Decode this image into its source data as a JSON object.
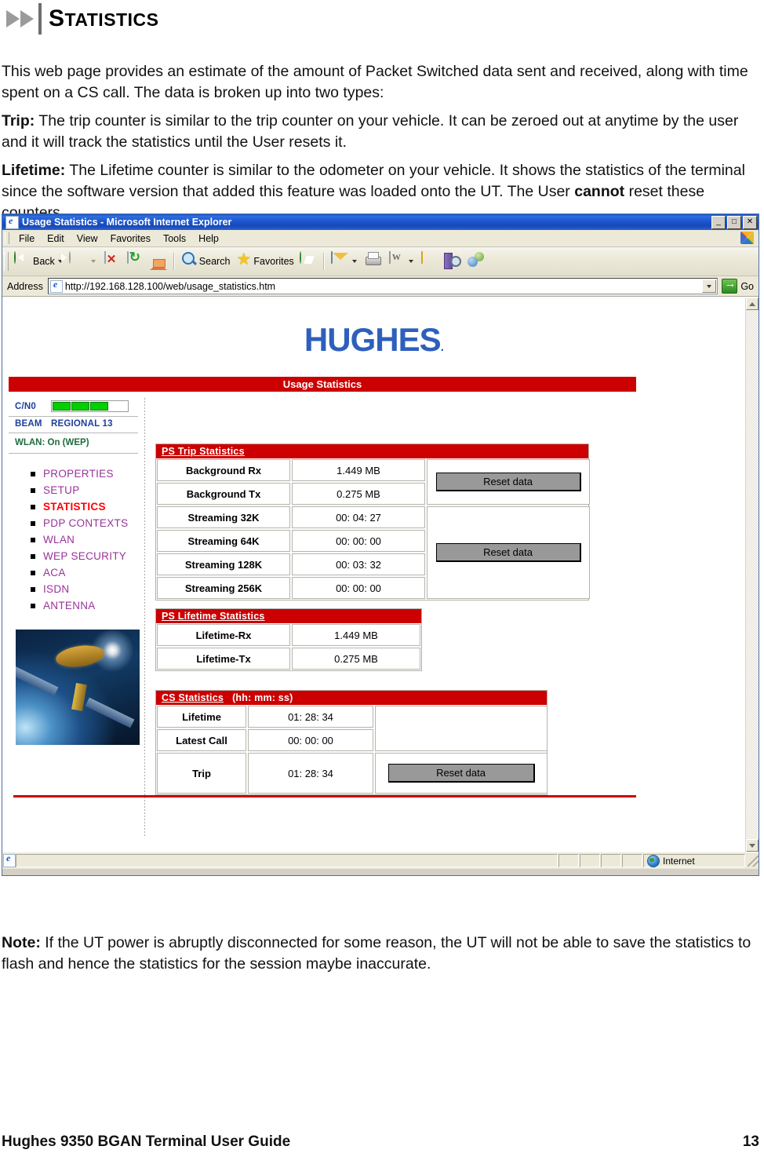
{
  "document": {
    "heading": "STATISTICS",
    "heading_first_letter": "S",
    "heading_rest": "TATISTICS",
    "paragraphs": {
      "intro": "This web page provides an estimate of the amount of Packet Switched data sent and received, along with time spent on a CS call.  The data is broken up into two types:",
      "trip_label": "Trip:",
      "trip_text": "  The trip counter is similar to the trip counter on your vehicle.  It can be zeroed out at anytime by the user and it will track the statistics until the User resets it.",
      "lifetime_label": "Lifetime:",
      "lifetime_text": "  The Lifetime counter is similar to the odometer on your vehicle.  It shows the statistics of the terminal since the software version that added this feature was loaded onto the UT.  The User ",
      "lifetime_bold2": "cannot",
      "lifetime_text2": " reset these counters.",
      "note_label": "Note:",
      "note_text": " If the UT power is abruptly disconnected for some reason, the UT will not be able to save the statistics to flash and hence the statistics for the session maybe inaccurate."
    },
    "footer": {
      "left": "Hughes 9350 BGAN Terminal User Guide",
      "right": "13"
    }
  },
  "browser": {
    "title": "Usage Statistics - Microsoft Internet Explorer",
    "window_buttons": [
      "minimize",
      "maximize",
      "close"
    ],
    "window_button_glyphs": [
      "_",
      "□",
      "✕"
    ],
    "menu": [
      "File",
      "Edit",
      "View",
      "Favorites",
      "Tools",
      "Help"
    ],
    "toolbar": {
      "back_label": "Back",
      "search_label": "Search",
      "favorites_label": "Favorites",
      "icons": [
        "back-icon",
        "forward-icon",
        "stop-icon",
        "refresh-icon",
        "home-icon",
        "search-icon",
        "favorites-star-icon",
        "media-icon",
        "mail-icon",
        "print-icon",
        "edit-word-icon",
        "notes-icon",
        "research-icon",
        "messenger-icon"
      ]
    },
    "address": {
      "label": "Address",
      "url": "http://192.168.128.100/web/usage_statistics.htm",
      "go_label": "Go"
    },
    "statusbar": {
      "zone": "Internet"
    }
  },
  "webpage": {
    "logo": "HUGHES",
    "logo_reg": ".",
    "banner": "Usage Statistics",
    "status": {
      "cn0_label": "C/N0",
      "cn0_bars": 3,
      "beam_label": "BEAM",
      "beam_value": "REGIONAL 13",
      "wlan": "WLAN: On (WEP)"
    },
    "nav": [
      {
        "label": "PROPERTIES",
        "active": false
      },
      {
        "label": "SETUP",
        "active": false
      },
      {
        "label": "STATISTICS",
        "active": true
      },
      {
        "label": "PDP CONTEXTS",
        "active": false
      },
      {
        "label": "WLAN",
        "active": false
      },
      {
        "label": "WEP SECURITY",
        "active": false
      },
      {
        "label": "ACA",
        "active": false
      },
      {
        "label": "ISDN",
        "active": false
      },
      {
        "label": "ANTENNA",
        "active": false
      }
    ],
    "sat_image_alt": "satellite-over-earth-image",
    "ps_trip": {
      "title": "PS Trip Statistics",
      "rows": [
        {
          "label": "Background Rx",
          "value": "1.449 MB"
        },
        {
          "label": "Background Tx",
          "value": "0.275 MB"
        },
        {
          "label": "Streaming 32K",
          "value": "00: 04: 27"
        },
        {
          "label": "Streaming 64K",
          "value": "00: 00: 00"
        },
        {
          "label": "Streaming 128K",
          "value": "00: 03: 32"
        },
        {
          "label": "Streaming 256K",
          "value": "00: 00: 00"
        }
      ],
      "reset_button_1": "Reset data",
      "reset_button_2": "Reset data"
    },
    "ps_lifetime": {
      "title": "PS Lifetime Statistics",
      "rows": [
        {
          "label": "Lifetime-Rx",
          "value": "1.449 MB"
        },
        {
          "label": "Lifetime-Tx",
          "value": "0.275 MB"
        }
      ]
    },
    "cs_stats": {
      "title": "CS Statistics",
      "title_suffix": "(hh: mm: ss)",
      "rows": [
        {
          "label": "Lifetime",
          "value": "01: 28: 34"
        },
        {
          "label": "Latest Call",
          "value": "00: 00: 00"
        },
        {
          "label": "Trip",
          "value": "01: 28: 34"
        }
      ],
      "reset_button": "Reset data"
    }
  },
  "colors": {
    "hughes_blue": "#2e5fbc",
    "banner_red": "#cc0000",
    "nav_link": "#993399",
    "nav_active": "#ff0000",
    "status_blue": "#1c3f99",
    "wlan_green": "#1f6b3f",
    "signal_green": "#00d000",
    "titlebar_blue": "#1c55cf"
  }
}
